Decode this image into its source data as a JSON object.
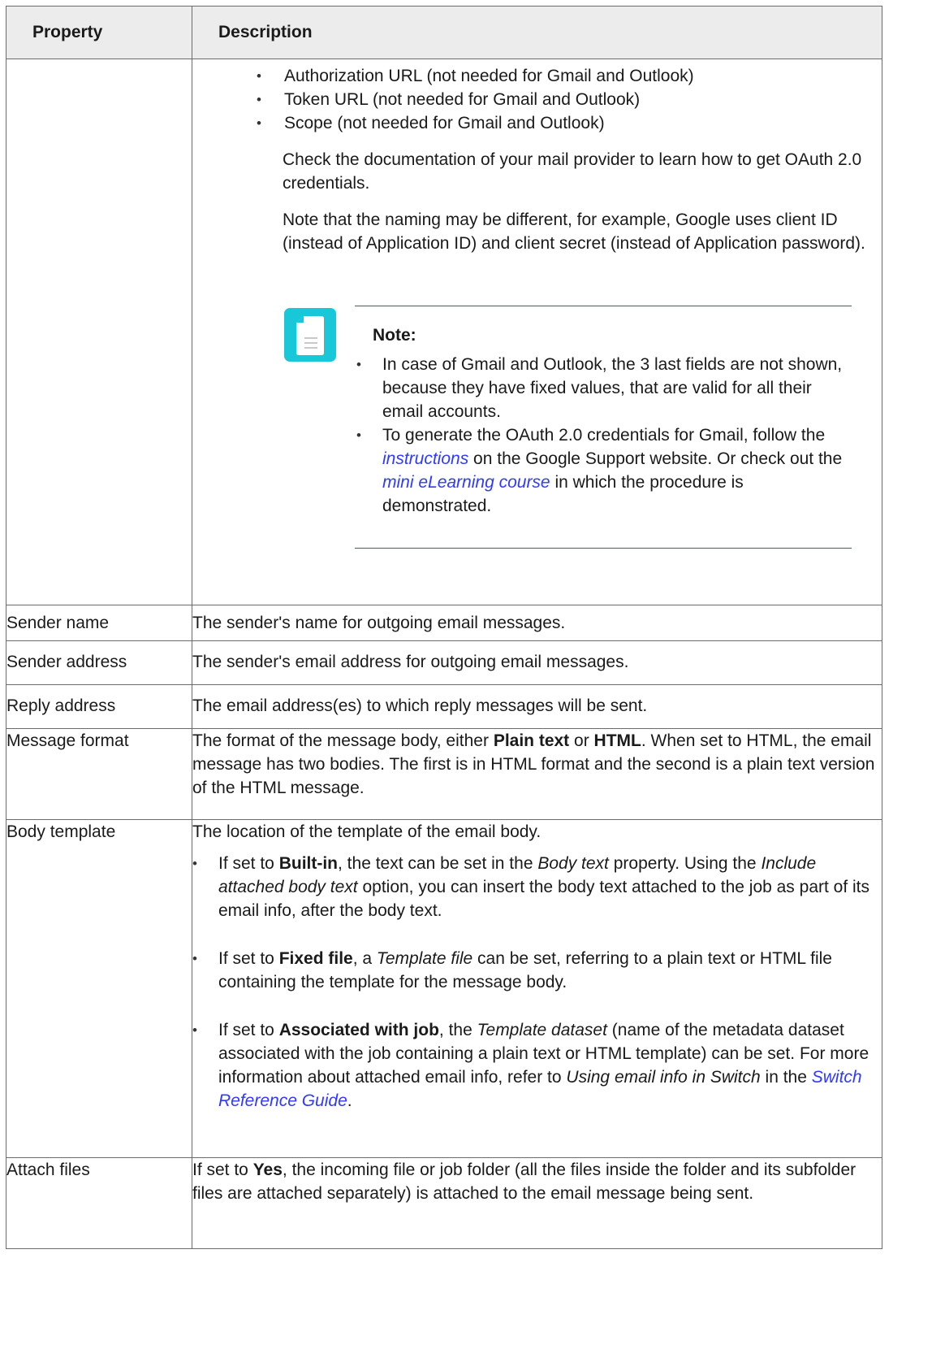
{
  "header": {
    "property": "Property",
    "description": "Description"
  },
  "oauth": {
    "bullets": [
      "Authorization URL (not needed for Gmail and Outlook)",
      "Token URL (not needed for Gmail and Outlook)",
      "Scope (not needed for Gmail and Outlook)"
    ],
    "para1": "Check the documentation of your mail provider to learn how to get OAuth 2.0 credentials.",
    "para2": "Note that the naming may be different, for example, Google uses client ID (instead of Application ID) and client secret (instead of Application password).",
    "note": {
      "title": "Note:",
      "item1": "In case of Gmail and Outlook, the 3 last fields are not shown, because they have fixed values, that are valid for all their email accounts.",
      "item2_a": "To generate the OAuth 2.0 credentials for Gmail, follow the ",
      "item2_link1": "instructions",
      "item2_b": " on the Google Support website. Or check out the ",
      "item2_link2": "mini eLearning course",
      "item2_c": " in which the procedure is demonstrated."
    }
  },
  "rows": {
    "sender_name": {
      "name": "Sender name",
      "desc": "The sender's name for outgoing email messages."
    },
    "sender_address": {
      "name": "Sender address",
      "desc": "The sender's email address for outgoing email messages."
    },
    "reply_address": {
      "name": "Reply address",
      "desc": "The email address(es) to which reply messages will be sent."
    },
    "message_format": {
      "name": "Message format",
      "a": "The format of the message body, either ",
      "b1": "Plain text",
      "c": " or ",
      "b2": "HTML",
      "d": ". When set to HTML, the email message has two bodies. The first is in HTML format and the second is a plain text version of the HTML message."
    },
    "body_template": {
      "name": "Body template",
      "intro": "The location of the template of the email body.",
      "i1_a": "If set to ",
      "i1_b": "Built-in",
      "i1_c": ", the text can be set in the ",
      "i1_d": "Body text",
      "i1_e": " property. Using the ",
      "i1_f": "Include attached body text",
      "i1_g": " option, you can insert the body text attached to the job as part of its email info, after the body text.",
      "i2_a": "If set to ",
      "i2_b": "Fixed file",
      "i2_c": ", a ",
      "i2_d": "Template file",
      "i2_e": " can be set, referring to a plain text or HTML file containing the template for the message body.",
      "i3_a": "If set to ",
      "i3_b": "Associated with job",
      "i3_c": ", the ",
      "i3_d": "Template dataset",
      "i3_e": " (name of the metadata dataset associated with the job containing a plain text or HTML template) can be set. For more information about attached email info, refer to ",
      "i3_f": "Using email info in Switch",
      "i3_g": " in the ",
      "i3_link": "Switch Reference Guide",
      "i3_h": "."
    },
    "attach_files": {
      "name": "Attach files",
      "a": "If set to ",
      "b": "Yes",
      "c": ", the incoming file or job folder (all the files inside the folder and its subfolder files are attached separately) is attached to the email message being sent."
    }
  },
  "colors": {
    "link": "#2f3aff",
    "note_icon": "#19c8d8",
    "header_bg": "#ececec"
  }
}
